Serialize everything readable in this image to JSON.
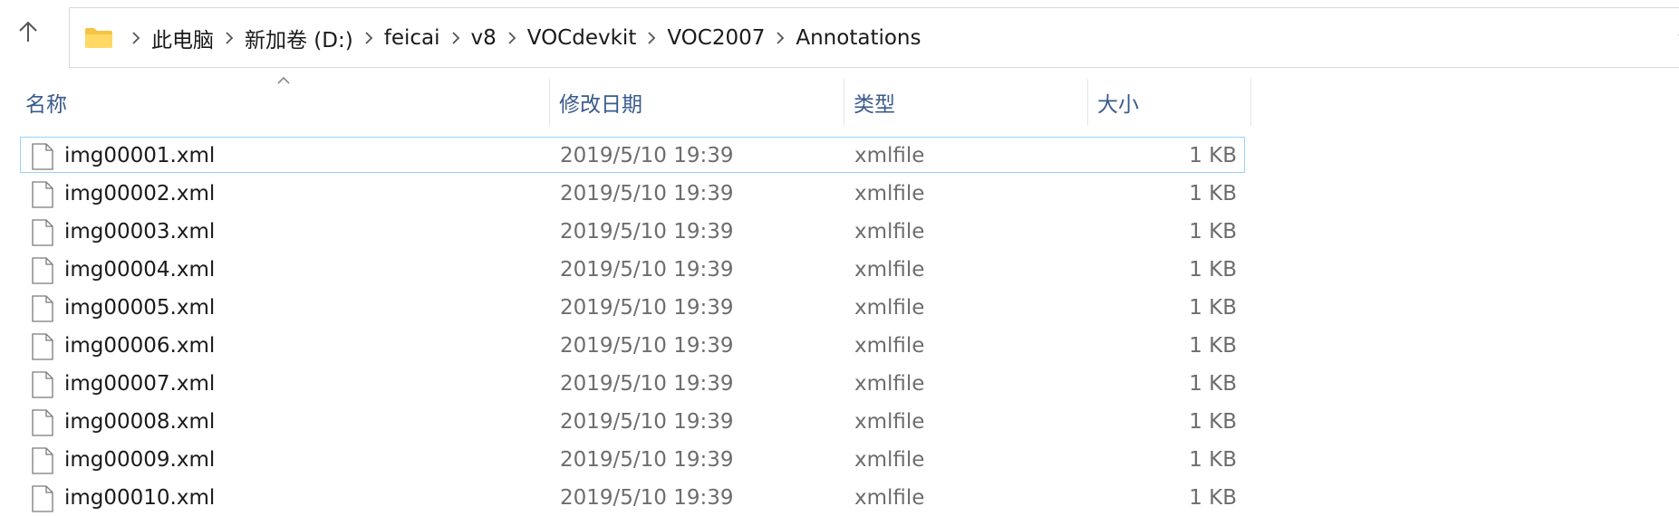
{
  "address": {
    "crumbs": [
      "此电脑",
      "新加卷 (D:)",
      "feicai",
      "v8",
      "VOCdevkit",
      "VOC2007",
      "Annotations"
    ]
  },
  "columns": {
    "name": "名称",
    "modified": "修改日期",
    "type": "类型",
    "size": "大小"
  },
  "files": [
    {
      "name": "img00001.xml",
      "modified": "2019/5/10 19:39",
      "type": "xmlfile",
      "size": "1 KB",
      "selected": true
    },
    {
      "name": "img00002.xml",
      "modified": "2019/5/10 19:39",
      "type": "xmlfile",
      "size": "1 KB"
    },
    {
      "name": "img00003.xml",
      "modified": "2019/5/10 19:39",
      "type": "xmlfile",
      "size": "1 KB"
    },
    {
      "name": "img00004.xml",
      "modified": "2019/5/10 19:39",
      "type": "xmlfile",
      "size": "1 KB"
    },
    {
      "name": "img00005.xml",
      "modified": "2019/5/10 19:39",
      "type": "xmlfile",
      "size": "1 KB"
    },
    {
      "name": "img00006.xml",
      "modified": "2019/5/10 19:39",
      "type": "xmlfile",
      "size": "1 KB"
    },
    {
      "name": "img00007.xml",
      "modified": "2019/5/10 19:39",
      "type": "xmlfile",
      "size": "1 KB"
    },
    {
      "name": "img00008.xml",
      "modified": "2019/5/10 19:39",
      "type": "xmlfile",
      "size": "1 KB"
    },
    {
      "name": "img00009.xml",
      "modified": "2019/5/10 19:39",
      "type": "xmlfile",
      "size": "1 KB"
    },
    {
      "name": "img00010.xml",
      "modified": "2019/5/10 19:39",
      "type": "xmlfile",
      "size": "1 KB"
    }
  ],
  "colors": {
    "header_text": "#3a5b8c",
    "selection_border": "#99d1ff",
    "folder_yellow": "#f6c443"
  },
  "icons": {
    "up": "arrow-up-icon",
    "folder": "folder-icon",
    "separator": "chevron-right-icon",
    "dropdown": "chevron-down-icon",
    "file": "file-icon",
    "sort": "sort-ascending-icon"
  }
}
